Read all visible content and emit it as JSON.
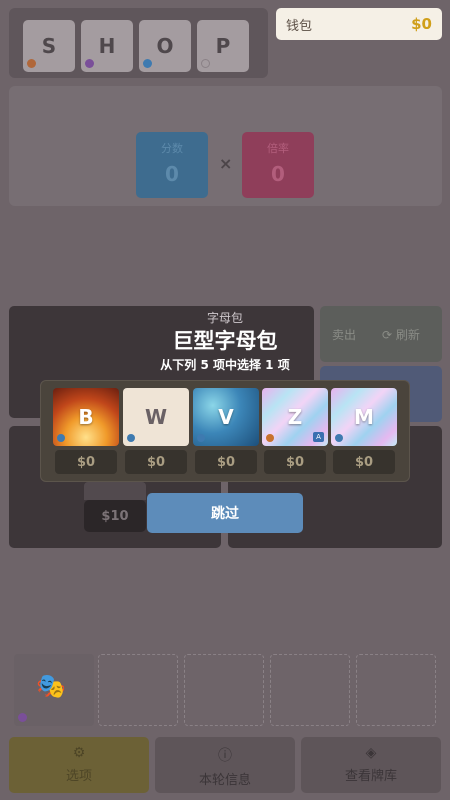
{
  "shop_tiles": [
    {
      "letter": "S",
      "dot_color": "#b0673a"
    },
    {
      "letter": "H",
      "dot_color": "#7a4f99"
    },
    {
      "letter": "O",
      "dot_color": "#3e7ab0"
    },
    {
      "letter": "P",
      "dot_color": "#a49ca0"
    }
  ],
  "wallet": {
    "label": "钱包",
    "value": "$0"
  },
  "score": {
    "label": "分数",
    "value": "0"
  },
  "mult": {
    "label": "倍率",
    "value": "0"
  },
  "times_symbol": "×",
  "side_panel": {
    "tab1": "卖出",
    "tab2": "刷新"
  },
  "bg_price": "$10",
  "pack": {
    "subtitle": "字母包",
    "title": "巨型字母包",
    "instruction": "从下列 5 项中选择 1 项",
    "cards": [
      {
        "letter": "B",
        "style": "fire",
        "dot_color": "#3e7ab0",
        "price": "$0"
      },
      {
        "letter": "W",
        "style": "plain",
        "dot_color": "#3e7ab0",
        "price": "$0"
      },
      {
        "letter": "V",
        "style": "ice",
        "dot_color": "#3e7ab0",
        "price": "$0"
      },
      {
        "letter": "Z",
        "style": "holo",
        "dot_color": "#c8722e",
        "price": "$0",
        "badge": "A"
      },
      {
        "letter": "M",
        "style": "holo",
        "dot_color": "#3e7ab0",
        "price": "$0"
      }
    ],
    "skip_label": "跳过"
  },
  "nav": {
    "options": {
      "icon": "⚙",
      "label": "选项"
    },
    "round_info": {
      "icon": "ⓘ",
      "label": "本轮信息"
    },
    "deck": {
      "icon": "◈",
      "label": "查看牌库"
    }
  },
  "colors": {
    "wallet_value": "#d09f1a",
    "skip_button": "#5d8cba",
    "score_chip": "#3e6c8f",
    "mult_chip": "#8f3e5a"
  }
}
